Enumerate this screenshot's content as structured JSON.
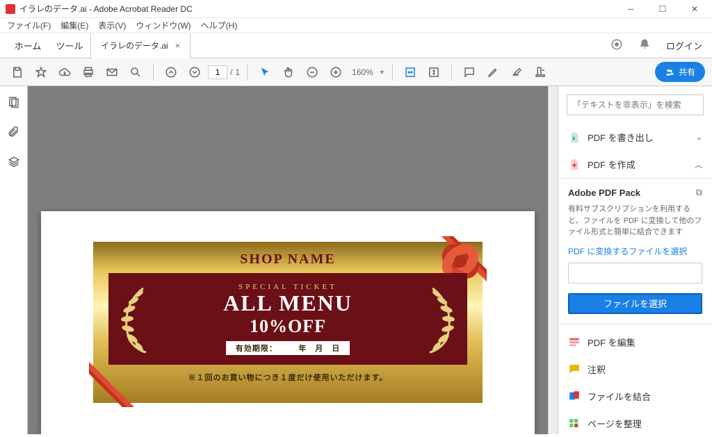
{
  "window": {
    "title": "イラレのデータ.ai - Adobe Acrobat Reader DC"
  },
  "menu": {
    "file": "ファイル(F)",
    "edit": "編集(E)",
    "view": "表示(V)",
    "window": "ウィンドウ(W)",
    "help": "ヘルプ(H)"
  },
  "tabs": {
    "home": "ホーム",
    "tool": "ツール",
    "doc": "イラレのデータ.ai",
    "login": "ログイン"
  },
  "toolbar": {
    "page_current": "1",
    "page_sep": "/",
    "page_total": "1",
    "zoom": "160%",
    "share": "共有"
  },
  "ticket": {
    "shop": "SHOP NAME",
    "special": "SPECIAL  TICKET",
    "allmenu": "ALL MENU",
    "pct": "10%OFF",
    "valid": "有効期限：　　　年　月　日",
    "note": "※１回のお買い物につき１度だけ使用いただけます。"
  },
  "right": {
    "search_placeholder": "「テキストを非表示」を検索",
    "export": "PDF を書き出し",
    "create": "PDF を作成",
    "pack_title": "Adobe PDF Pack",
    "pack_desc": "有料サブスクリプションを利用すると、ファイルを PDF に変換して他のファイル形式と簡単に結合できます",
    "pack_link": "PDF に変換するファイルを選択",
    "select_btn": "ファイルを選択",
    "edit": "PDF を編集",
    "comment": "注釈",
    "combine": "ファイルを結合",
    "organize": "ページを整理"
  }
}
